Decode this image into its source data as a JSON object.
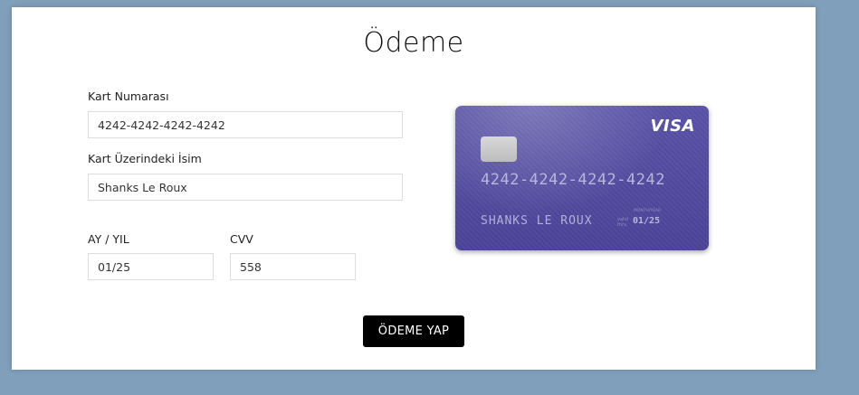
{
  "page": {
    "title": "Ödeme"
  },
  "form": {
    "card_number": {
      "label": "Kart Numarası",
      "value": "4242-4242-4242-4242"
    },
    "card_name": {
      "label": "Kart Üzerindeki İsim",
      "value": "Shanks Le Roux"
    },
    "expiry": {
      "label": "AY / YIL",
      "value": "01/25"
    },
    "cvv": {
      "label": "CVV",
      "value": "558"
    },
    "submit_label": "ÖDEME YAP"
  },
  "card_preview": {
    "brand": "VISA",
    "number": "4242-4242-4242-4242",
    "holder": "SHANKS LE ROUX",
    "valid_text": "valid thru",
    "month_year_text": "MONTH/YEAR",
    "expiry": "01/25",
    "chip_icon": "card-chip-icon"
  },
  "colors": {
    "background": "#7f9fbb",
    "panel": "#ffffff",
    "card": "#514a9f",
    "button": "#000000"
  }
}
